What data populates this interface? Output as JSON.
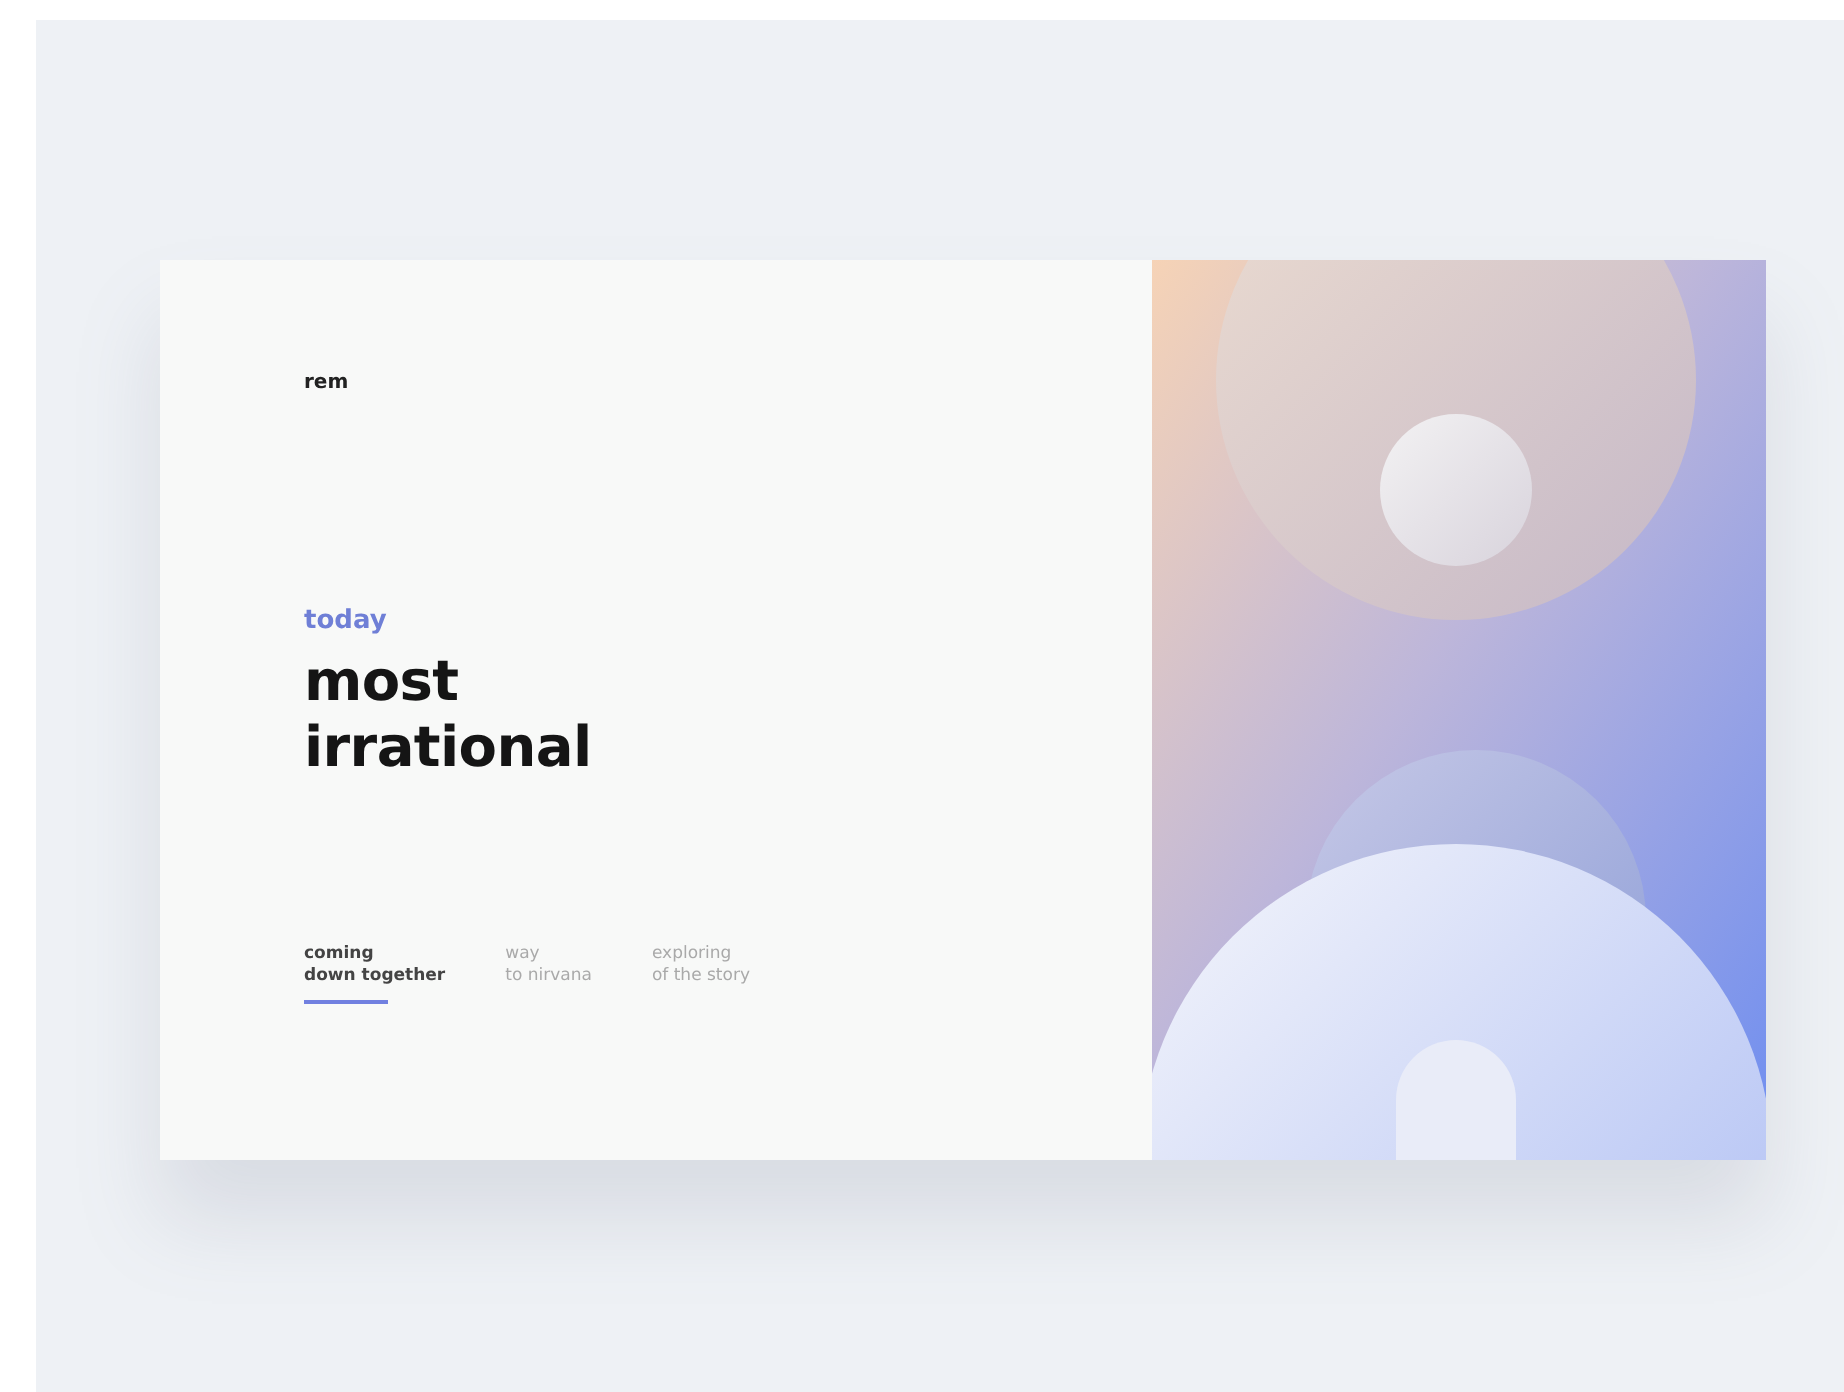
{
  "brand": "rem",
  "eyebrow": "today",
  "headline": [
    "most",
    "irrational"
  ],
  "nav": [
    {
      "line1": "coming",
      "line2": "down together",
      "selected": true
    },
    {
      "line1": "way",
      "line2": "to nirvana",
      "selected": false
    },
    {
      "line1": "exploring",
      "line2": "of the story",
      "selected": false
    }
  ]
}
